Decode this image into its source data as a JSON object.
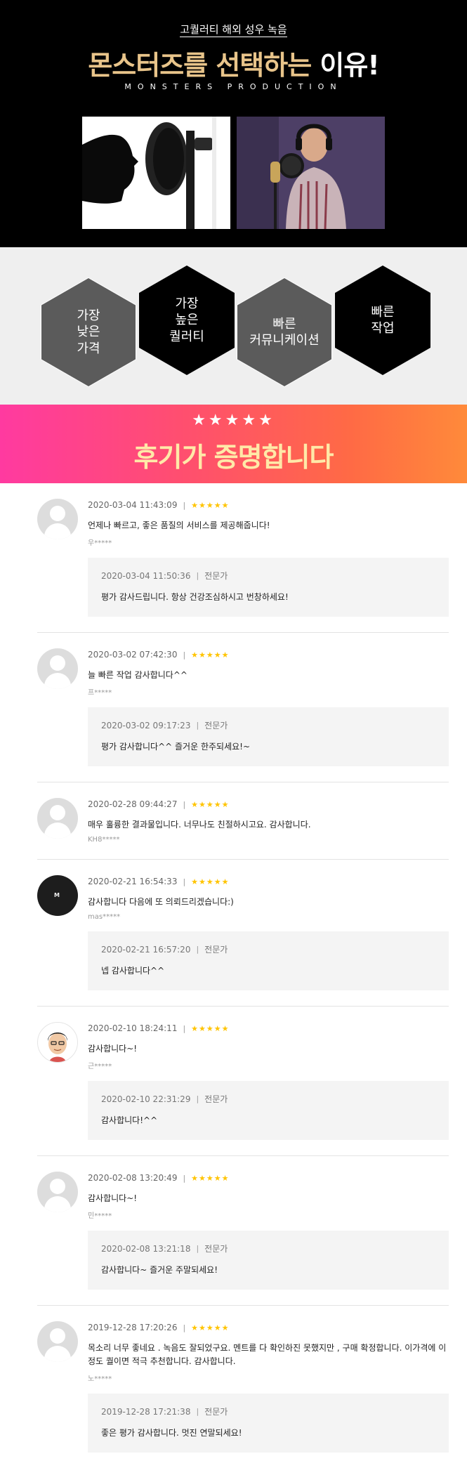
{
  "hero": {
    "kicker": "고퀄러티 해외 성우 녹음",
    "headline_gold": "몬스터즈를 선택하는",
    "headline_white": "이유!",
    "brand": "MONSTERS PRODUCTION"
  },
  "features": [
    {
      "label": "가장\n낮은\n가격",
      "style": "grey"
    },
    {
      "label": "가장\n높은\n퀄러티",
      "style": "black"
    },
    {
      "label": "빠른\n커뮤니케이션",
      "style": "grey"
    },
    {
      "label": "빠른\n작업",
      "style": "black"
    }
  ],
  "banner": {
    "stars": "★★★★★",
    "title": "후기가 증명합니다"
  },
  "rating_stars": "★★★★★",
  "separator": "|",
  "reviews": [
    {
      "avatar": "default-avatar",
      "date": "2020-03-04 11:43:09",
      "text": "언제나 빠르고, 좋은 품질의 서비스를 제공해줍니다!",
      "author": "우*****",
      "reply": {
        "date": "2020-03-04 11:50:36",
        "role": "전문가",
        "text": "평가 감사드립니다. 항상 건강조심하시고 번창하세요!"
      }
    },
    {
      "avatar": "default-avatar",
      "date": "2020-03-02 07:42:30",
      "text": "늘 빠른 작업 감사합니다^^",
      "author": "프*****",
      "reply": {
        "date": "2020-03-02 09:17:23",
        "role": "전문가",
        "text": "평가 감사합니다^^ 즐거운 한주되세요!~"
      }
    },
    {
      "avatar": "default-avatar",
      "date": "2020-02-28 09:44:27",
      "text": "매우 훌륭한 결과물입니다. 너무나도 친절하시고요. 감사합니다.",
      "author": "KH8*****"
    },
    {
      "avatar": "logo-avatar",
      "date": "2020-02-21 16:54:33",
      "text": "감사합니다 다음에 또 의뢰드리겠습니다:)",
      "author": "mas*****",
      "reply": {
        "date": "2020-02-21 16:57:20",
        "role": "전문가",
        "text": "넵 감사합니다^^"
      }
    },
    {
      "avatar": "cartoon-avatar",
      "date": "2020-02-10 18:24:11",
      "text": "감사합니다~!",
      "author": "근*****",
      "reply": {
        "date": "2020-02-10 22:31:29",
        "role": "전문가",
        "text": "감사합니다!^^"
      }
    },
    {
      "avatar": "default-avatar",
      "date": "2020-02-08 13:20:49",
      "text": "감사합니다~!",
      "author": "민*****",
      "reply": {
        "date": "2020-02-08 13:21:18",
        "role": "전문가",
        "text": "감사합니다~ 즐거운 주말되세요!"
      }
    },
    {
      "avatar": "default-avatar",
      "date": "2019-12-28 17:20:26",
      "text": "목소리 너무 좋네요 . 녹음도 잘되었구요. 멘트를 다 확인하진 못했지만 , 구매 확정합니다. 이가격에 이정도 퀄이면 적극 추천합니다. 감사합니다.",
      "author": "노*****",
      "reply": {
        "date": "2019-12-28 17:21:38",
        "role": "전문가",
        "text": "좋은 평가 감사합니다. 멋진 연말되세요!"
      }
    }
  ]
}
